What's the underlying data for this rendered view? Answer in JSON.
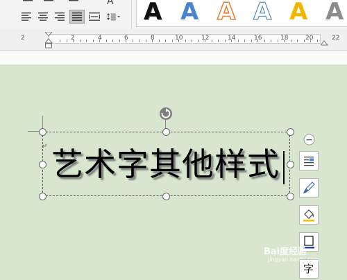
{
  "wordart_gallery": {
    "styles": [
      {
        "letter": "A",
        "fill": "#111111",
        "outline": "#ffffff",
        "name": "wordart-style-black"
      },
      {
        "letter": "A",
        "fill": "#4a86c8",
        "outline": "#4a86c8",
        "name": "wordart-style-blue"
      },
      {
        "letter": "A",
        "fill": "#ffffff",
        "outline": "#e8803a",
        "name": "wordart-style-orange-outline"
      },
      {
        "letter": "A",
        "fill": "#ffffff",
        "outline": "#5b8fc9",
        "name": "wordart-style-blue-outline"
      },
      {
        "letter": "A",
        "fill": "#f2b600",
        "outline": "#f2b600",
        "name": "wordart-style-gold"
      },
      {
        "letter": "A",
        "fill": "#8c8c8c",
        "outline": "#8c8c8c",
        "name": "wordart-style-gray"
      }
    ]
  },
  "ribbon": {
    "partial_glyph": "A"
  },
  "ruler": {
    "left_numbers": [
      "2"
    ],
    "numbers": [
      "2",
      "4",
      "6",
      "8",
      "10",
      "12",
      "14",
      "16",
      "18",
      "20",
      "22"
    ]
  },
  "document": {
    "wordart_text": "艺术字其他样式",
    "paragraph_mark": "↵"
  },
  "side_tools": {
    "char_tool_label": "字"
  },
  "watermark": {
    "brand": "Bai度经验",
    "url": "jingyan.baidu.com"
  }
}
